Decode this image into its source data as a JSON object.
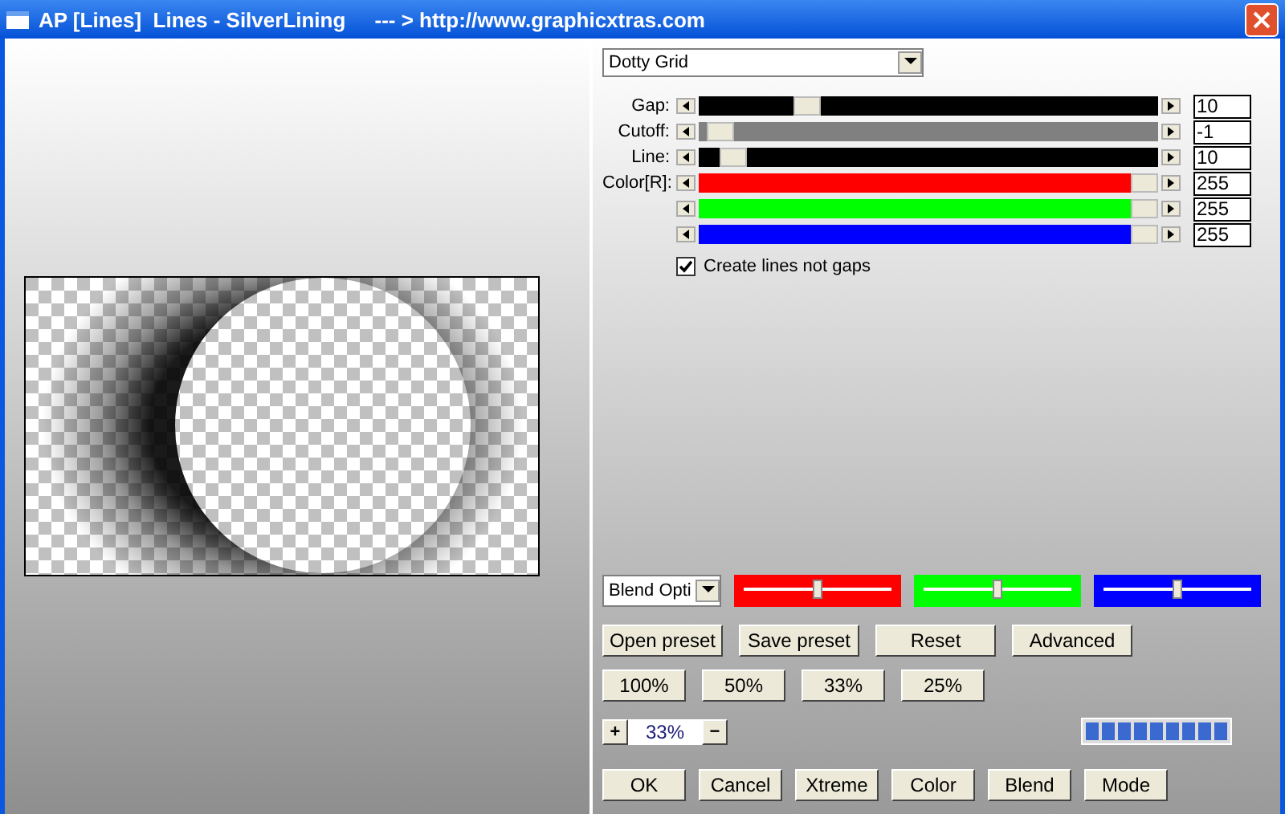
{
  "window": {
    "title": "AP [Lines]  Lines - SilverLining     --- > http://www.graphicxtras.com"
  },
  "pattern_dropdown": {
    "value": "Dotty Grid"
  },
  "sliders": [
    {
      "label": "Gap:",
      "color": "#000000",
      "level": 0.22,
      "value": "10"
    },
    {
      "label": "Cutoff:",
      "color": "#808080",
      "level": 0.02,
      "value": "-1"
    },
    {
      "label": "Line:",
      "color": "#000000",
      "level": 0.05,
      "value": "10"
    },
    {
      "label": "Color[R]:",
      "color": "#ff0000",
      "level": 1.0,
      "value": "255"
    },
    {
      "color": "#00ff00",
      "level": 1.0,
      "value": "255"
    },
    {
      "color": "#0000ff",
      "level": 1.0,
      "value": "255"
    }
  ],
  "create_lines_checkbox": {
    "label": "Create lines not gaps",
    "checked": true
  },
  "blend_dropdown": {
    "value": "Blend Opti"
  },
  "blend_sliders": [
    {
      "color": "#ff0000",
      "level": 0.5
    },
    {
      "color": "#00ff00",
      "level": 0.5
    },
    {
      "color": "#0000ff",
      "level": 0.5
    }
  ],
  "preset_buttons": [
    "Open preset",
    "Save preset",
    "Reset",
    "Advanced"
  ],
  "zoom_buttons": [
    "100%",
    "50%",
    "33%",
    "25%"
  ],
  "zoom_stepper": {
    "plus": "+",
    "value": "33%",
    "minus": "−"
  },
  "bottom_buttons": [
    "OK",
    "Cancel",
    "Xtreme",
    "Color",
    "Blend",
    "Mode"
  ]
}
